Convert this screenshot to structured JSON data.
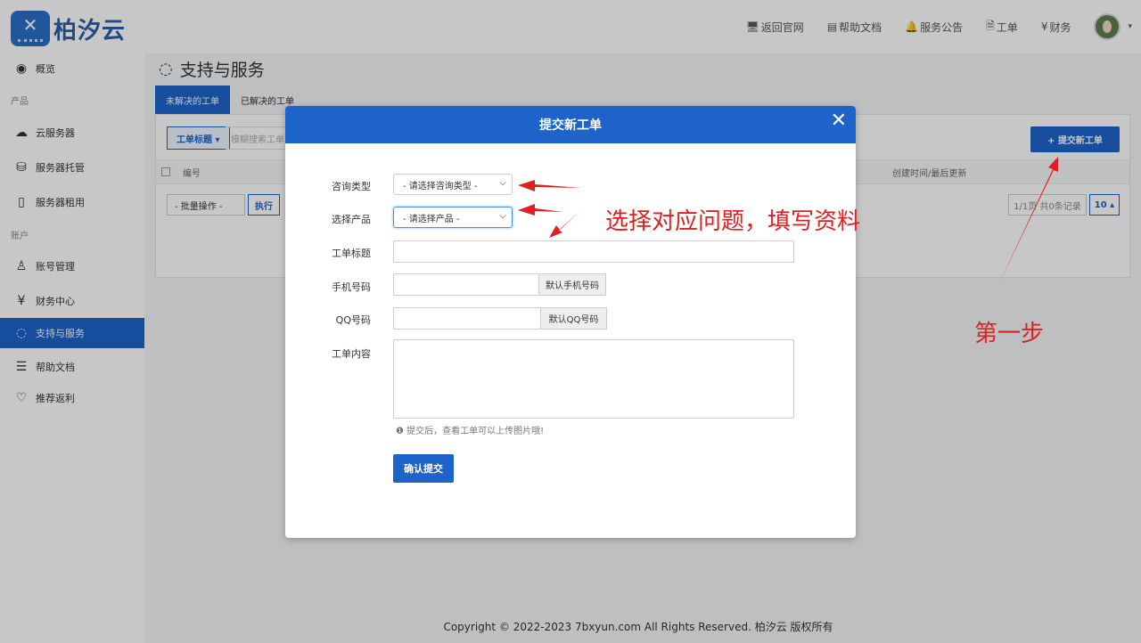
{
  "brand": {
    "logo_text": "柏汐云",
    "logo_mark": "✕"
  },
  "topnav": [
    {
      "icon": "🖥",
      "label": "返回官网"
    },
    {
      "icon": "▤",
      "label": "帮助文档"
    },
    {
      "icon": "🔔",
      "label": "服务公告"
    },
    {
      "icon": "🗎",
      "label": "工单"
    },
    {
      "icon": "¥",
      "label": "财务"
    }
  ],
  "sidebar": {
    "overview": {
      "icon": "◉",
      "label": "概览"
    },
    "group_products": "产品",
    "cloud_server": {
      "icon": "☁",
      "label": "云服务器"
    },
    "hosting": {
      "icon": "⛁",
      "label": "服务器托管"
    },
    "rental": {
      "icon": "▯",
      "label": "服务器租用"
    },
    "group_account": "账户",
    "account": {
      "icon": "♙",
      "label": "账号管理"
    },
    "finance": {
      "icon": "¥",
      "label": "财务中心"
    },
    "support": {
      "icon": "◌",
      "label": "支持与服务"
    },
    "docs": {
      "icon": "☰",
      "label": "帮助文档"
    },
    "referral": {
      "icon": "♡",
      "label": "推荐返利"
    }
  },
  "page": {
    "title_icon": "◌",
    "title": "支持与服务",
    "tabs": [
      "未解决的工单",
      "已解决的工单"
    ],
    "filter_label": "工单标题 ▾",
    "filter_placeholder": "模糊搜索工单",
    "new_ticket_label": "+ 提交新工单",
    "col_number": "编号",
    "col_date": "创建时间/最后更新",
    "bulk_label": "- 批量操作 -",
    "exec_label": "执行",
    "pager_label": "1/1页 共0条记录",
    "perpage_label": "10 ▴"
  },
  "footer": "Copyright © 2022-2023 7bxyun.com All Rights Reserved. 柏汐云 版权所有",
  "modal": {
    "title": "提交新工单",
    "close": "✕",
    "type_label": "咨询类型",
    "type_value": "- 请选择咨询类型 -",
    "product_label": "选择产品",
    "product_value": "- 请选择产品 -",
    "subject_label": "工单标题",
    "phone_label": "手机号码",
    "phone_default": "默认手机号码",
    "qq_label": "QQ号码",
    "qq_default": "默认QQ号码",
    "content_label": "工单内容",
    "hint": "❶ 提交后，查看工单可以上传图片哦!",
    "submit": "确认提交"
  },
  "annotations": {
    "instruction": "选择对应问题，填写资料",
    "step": "第一步",
    "color": "#e02020"
  }
}
